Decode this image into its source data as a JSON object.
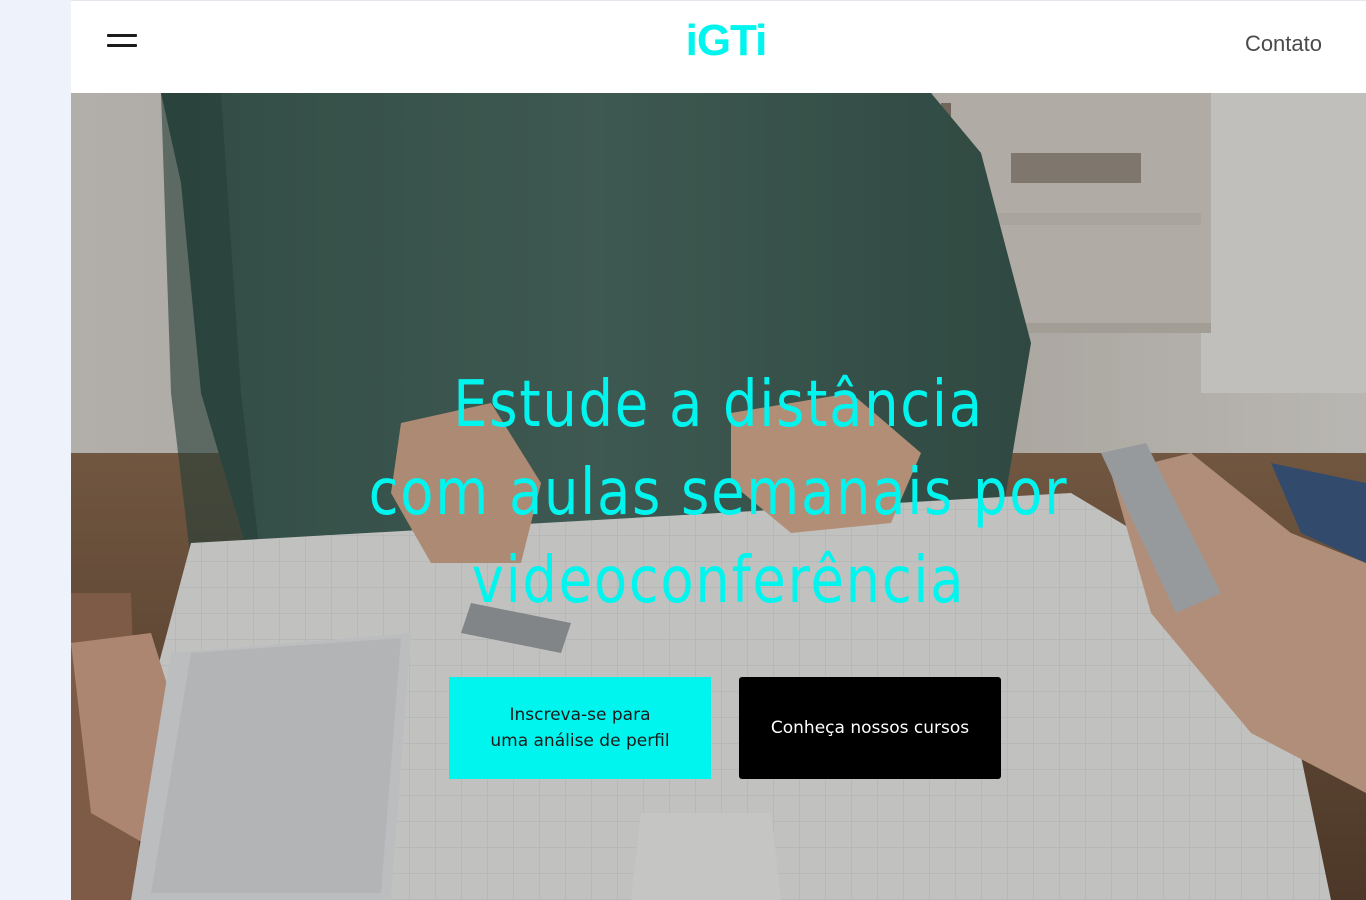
{
  "header": {
    "logo_text": "iGTi",
    "contato_label": "Contato",
    "menu_icon": "hamburger-menu-icon"
  },
  "hero": {
    "title_lines": [
      "Estude a distância",
      "com aulas semanais por",
      "videoconferência"
    ],
    "primary_button_lines": [
      "Inscreva-se para",
      "uma análise de perfil"
    ],
    "secondary_button_label": "Conheça nossos cursos"
  },
  "colors": {
    "accent": "#00f5ee",
    "page_background": "#eef3fb",
    "header_background": "#ffffff",
    "secondary_button_background": "#000000"
  }
}
